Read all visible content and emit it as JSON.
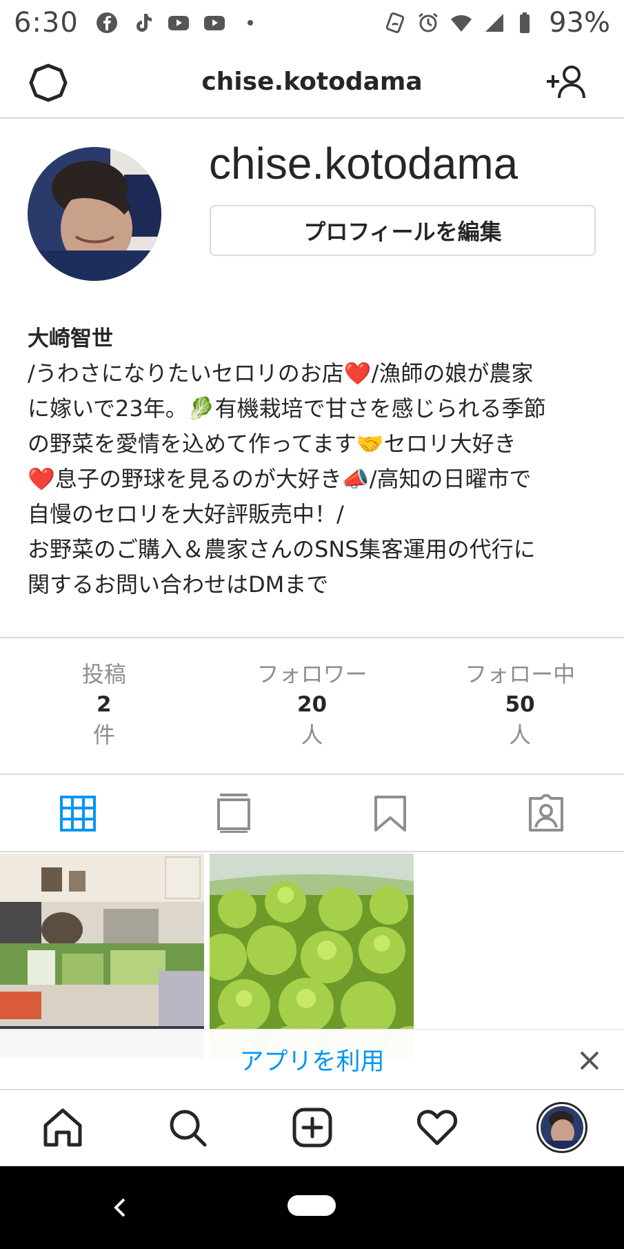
{
  "status_bar": {
    "time": "6:30",
    "battery": "93%",
    "left_icons": [
      "facebook-icon",
      "tiktok-icon",
      "youtube-icon",
      "youtube-icon",
      "dot-icon"
    ],
    "right_icons": [
      "nfc-icon",
      "alarm-icon",
      "wifi-icon",
      "signal-icon",
      "battery-icon"
    ]
  },
  "header": {
    "title": "chise.kotodama"
  },
  "profile": {
    "username": "chise.kotodama",
    "edit_button": "プロフィールを編集",
    "name": "大崎智世",
    "bio_lines": [
      "/うわさになりたいセロリのお店❤️/漁師の娘が農家",
      "に嫁いで23年。🥬有機栽培で甘さを感じられる季節",
      "の野菜を愛情を込めて作ってます🤝セロリ大好き",
      "❤️息子の野球を見るのが大好き📣/高知の日曜市で",
      "自慢のセロリを大好評販売中！/",
      "お野菜のご購入＆農家さんのSNS集客運用の代行に",
      "関するお問い合わせはDMまで"
    ]
  },
  "stats": [
    {
      "label": "投稿",
      "value": "2",
      "unit": "件"
    },
    {
      "label": "フォロワー",
      "value": "20",
      "unit": "人"
    },
    {
      "label": "フォロー中",
      "value": "50",
      "unit": "人"
    }
  ],
  "tabs": [
    "grid-icon",
    "feed-icon",
    "bookmark-icon",
    "tagged-icon"
  ],
  "app_banner": {
    "text": "アプリを利用"
  },
  "colors": {
    "accent": "#0095f6",
    "border": "#dbdbdb",
    "muted": "#8e8e8e",
    "text": "#262626"
  }
}
